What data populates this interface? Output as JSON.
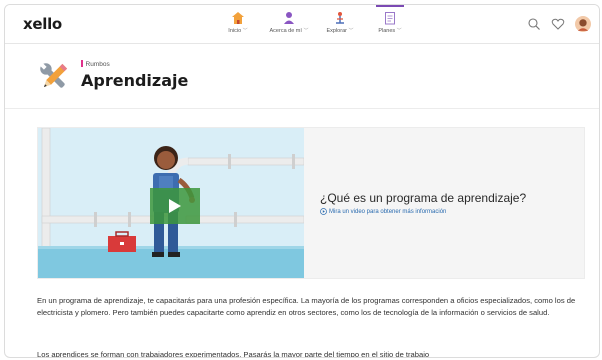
{
  "app": {
    "logo": "xello"
  },
  "nav": {
    "items": [
      {
        "label": "Inicio",
        "caret": "﹀",
        "icon": "house-icon"
      },
      {
        "label": "Acerca de mí",
        "caret": "﹀",
        "icon": "person-icon"
      },
      {
        "label": "Explorar",
        "caret": "﹀",
        "icon": "compass-icon"
      },
      {
        "label": "Planes",
        "caret": "﹀",
        "icon": "clipboard-icon"
      }
    ],
    "right_icons": [
      "search-icon",
      "heart-icon",
      "avatar"
    ]
  },
  "header": {
    "breadcrumb": "Rumbos",
    "title": "Aprendizaje",
    "icon": "tools-icon"
  },
  "card": {
    "title": "¿Qué es un programa de aprendizaje?",
    "link": "Mira un video para obtener más información",
    "link_icon": "play-circle-icon"
  },
  "body": {
    "paragraph1": "En un programa de aprendizaje, te capacitarás para una profesión específica. La mayoría de los programas corresponden a oficios especializados, como los de electricista y plomero. Pero también puedes capacitarte como aprendiz en otros sectores, como los de tecnología de la información o servicios de salud.",
    "paragraph2": "Los aprendices se forman con trabajadores experimentados. Pasarás la mayor parte del tiempo en el sitio de trabajo"
  },
  "colors": {
    "accent_purple": "#7b4ab3",
    "breadcrumb_bar": "#e0318a",
    "link_blue": "#2b6cb0",
    "illustration_sky": "#d9eef7",
    "illustration_water": "#7fc8e0"
  }
}
